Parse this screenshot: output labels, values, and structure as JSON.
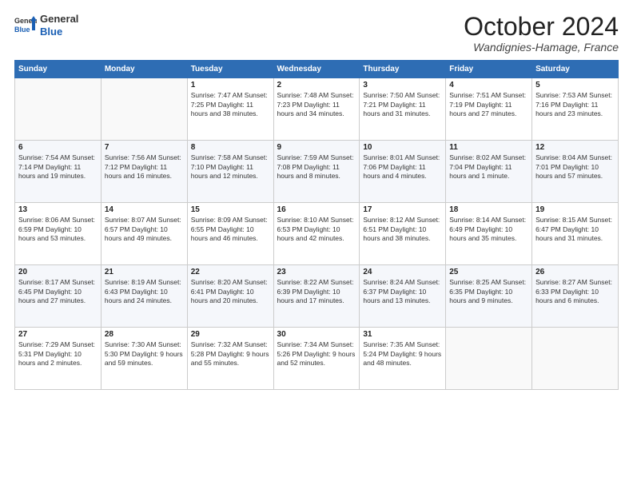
{
  "header": {
    "logo_general": "General",
    "logo_blue": "Blue",
    "month": "October 2024",
    "location": "Wandignies-Hamage, France"
  },
  "days_of_week": [
    "Sunday",
    "Monday",
    "Tuesday",
    "Wednesday",
    "Thursday",
    "Friday",
    "Saturday"
  ],
  "weeks": [
    [
      {
        "day": "",
        "info": ""
      },
      {
        "day": "",
        "info": ""
      },
      {
        "day": "1",
        "info": "Sunrise: 7:47 AM\nSunset: 7:25 PM\nDaylight: 11 hours\nand 38 minutes."
      },
      {
        "day": "2",
        "info": "Sunrise: 7:48 AM\nSunset: 7:23 PM\nDaylight: 11 hours\nand 34 minutes."
      },
      {
        "day": "3",
        "info": "Sunrise: 7:50 AM\nSunset: 7:21 PM\nDaylight: 11 hours\nand 31 minutes."
      },
      {
        "day": "4",
        "info": "Sunrise: 7:51 AM\nSunset: 7:19 PM\nDaylight: 11 hours\nand 27 minutes."
      },
      {
        "day": "5",
        "info": "Sunrise: 7:53 AM\nSunset: 7:16 PM\nDaylight: 11 hours\nand 23 minutes."
      }
    ],
    [
      {
        "day": "6",
        "info": "Sunrise: 7:54 AM\nSunset: 7:14 PM\nDaylight: 11 hours\nand 19 minutes."
      },
      {
        "day": "7",
        "info": "Sunrise: 7:56 AM\nSunset: 7:12 PM\nDaylight: 11 hours\nand 16 minutes."
      },
      {
        "day": "8",
        "info": "Sunrise: 7:58 AM\nSunset: 7:10 PM\nDaylight: 11 hours\nand 12 minutes."
      },
      {
        "day": "9",
        "info": "Sunrise: 7:59 AM\nSunset: 7:08 PM\nDaylight: 11 hours\nand 8 minutes."
      },
      {
        "day": "10",
        "info": "Sunrise: 8:01 AM\nSunset: 7:06 PM\nDaylight: 11 hours\nand 4 minutes."
      },
      {
        "day": "11",
        "info": "Sunrise: 8:02 AM\nSunset: 7:04 PM\nDaylight: 11 hours\nand 1 minute."
      },
      {
        "day": "12",
        "info": "Sunrise: 8:04 AM\nSunset: 7:01 PM\nDaylight: 10 hours\nand 57 minutes."
      }
    ],
    [
      {
        "day": "13",
        "info": "Sunrise: 8:06 AM\nSunset: 6:59 PM\nDaylight: 10 hours\nand 53 minutes."
      },
      {
        "day": "14",
        "info": "Sunrise: 8:07 AM\nSunset: 6:57 PM\nDaylight: 10 hours\nand 49 minutes."
      },
      {
        "day": "15",
        "info": "Sunrise: 8:09 AM\nSunset: 6:55 PM\nDaylight: 10 hours\nand 46 minutes."
      },
      {
        "day": "16",
        "info": "Sunrise: 8:10 AM\nSunset: 6:53 PM\nDaylight: 10 hours\nand 42 minutes."
      },
      {
        "day": "17",
        "info": "Sunrise: 8:12 AM\nSunset: 6:51 PM\nDaylight: 10 hours\nand 38 minutes."
      },
      {
        "day": "18",
        "info": "Sunrise: 8:14 AM\nSunset: 6:49 PM\nDaylight: 10 hours\nand 35 minutes."
      },
      {
        "day": "19",
        "info": "Sunrise: 8:15 AM\nSunset: 6:47 PM\nDaylight: 10 hours\nand 31 minutes."
      }
    ],
    [
      {
        "day": "20",
        "info": "Sunrise: 8:17 AM\nSunset: 6:45 PM\nDaylight: 10 hours\nand 27 minutes."
      },
      {
        "day": "21",
        "info": "Sunrise: 8:19 AM\nSunset: 6:43 PM\nDaylight: 10 hours\nand 24 minutes."
      },
      {
        "day": "22",
        "info": "Sunrise: 8:20 AM\nSunset: 6:41 PM\nDaylight: 10 hours\nand 20 minutes."
      },
      {
        "day": "23",
        "info": "Sunrise: 8:22 AM\nSunset: 6:39 PM\nDaylight: 10 hours\nand 17 minutes."
      },
      {
        "day": "24",
        "info": "Sunrise: 8:24 AM\nSunset: 6:37 PM\nDaylight: 10 hours\nand 13 minutes."
      },
      {
        "day": "25",
        "info": "Sunrise: 8:25 AM\nSunset: 6:35 PM\nDaylight: 10 hours\nand 9 minutes."
      },
      {
        "day": "26",
        "info": "Sunrise: 8:27 AM\nSunset: 6:33 PM\nDaylight: 10 hours\nand 6 minutes."
      }
    ],
    [
      {
        "day": "27",
        "info": "Sunrise: 7:29 AM\nSunset: 5:31 PM\nDaylight: 10 hours\nand 2 minutes."
      },
      {
        "day": "28",
        "info": "Sunrise: 7:30 AM\nSunset: 5:30 PM\nDaylight: 9 hours\nand 59 minutes."
      },
      {
        "day": "29",
        "info": "Sunrise: 7:32 AM\nSunset: 5:28 PM\nDaylight: 9 hours\nand 55 minutes."
      },
      {
        "day": "30",
        "info": "Sunrise: 7:34 AM\nSunset: 5:26 PM\nDaylight: 9 hours\nand 52 minutes."
      },
      {
        "day": "31",
        "info": "Sunrise: 7:35 AM\nSunset: 5:24 PM\nDaylight: 9 hours\nand 48 minutes."
      },
      {
        "day": "",
        "info": ""
      },
      {
        "day": "",
        "info": ""
      }
    ]
  ]
}
